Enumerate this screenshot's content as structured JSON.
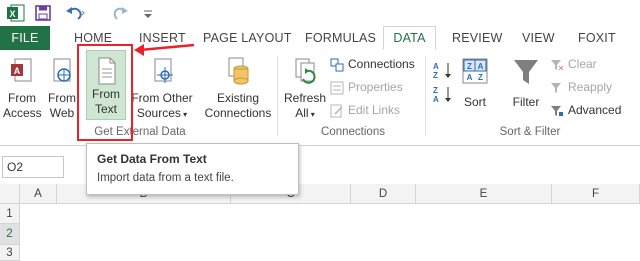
{
  "quick_access": {
    "icons": [
      "excel-logo-icon",
      "save-icon",
      "undo-icon",
      "redo-icon",
      "customize-icon"
    ]
  },
  "tabs": [
    {
      "label": "FILE"
    },
    {
      "label": "HOME"
    },
    {
      "label": "INSERT"
    },
    {
      "label": "PAGE LAYOUT"
    },
    {
      "label": "FORMULAS"
    },
    {
      "label": "DATA"
    },
    {
      "label": "REVIEW"
    },
    {
      "label": "VIEW"
    },
    {
      "label": "FOXIT PDF"
    }
  ],
  "ribbon": {
    "get_external_data": {
      "group_label": "Get External Data",
      "from_access": {
        "line1": "From",
        "line2": "Access"
      },
      "from_web": {
        "line1": "From",
        "line2": "Web"
      },
      "from_text": {
        "line1": "From",
        "line2": "Text"
      },
      "from_other": {
        "line1": "From Other",
        "line2": "Sources"
      },
      "existing": {
        "line1": "Existing",
        "line2": "Connections"
      }
    },
    "connections": {
      "group_label": "Connections",
      "refresh": {
        "line1": "Refresh",
        "line2": "All"
      },
      "connections_label": "Connections",
      "properties_label": "Properties",
      "edit_links_label": "Edit Links"
    },
    "sort_filter": {
      "group_label": "Sort & Filter",
      "sort_label": "Sort",
      "filter_label": "Filter",
      "clear_label": "Clear",
      "reapply_label": "Reapply",
      "advanced_label": "Advanced"
    }
  },
  "name_box": {
    "value": "O2"
  },
  "columns": [
    "A",
    "B",
    "C",
    "D",
    "E",
    "F"
  ],
  "rows": [
    "1",
    "2",
    "3"
  ],
  "tooltip": {
    "title": "Get Data From Text",
    "description": "Import data from a text file."
  },
  "colors": {
    "accent": "#217346",
    "highlight": "#e8232a"
  }
}
